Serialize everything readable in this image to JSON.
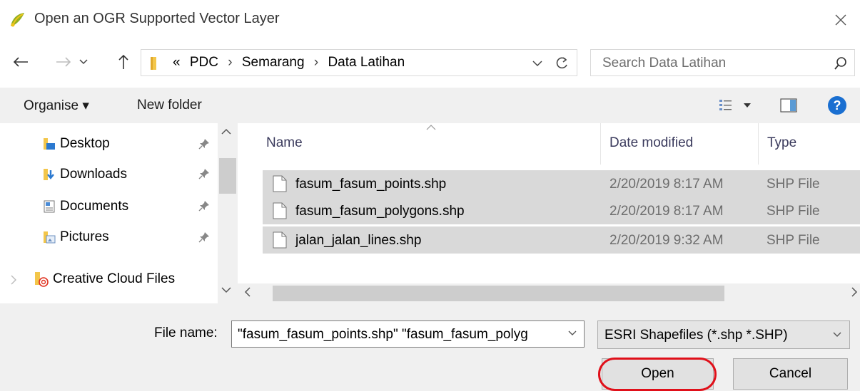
{
  "window": {
    "title": "Open an OGR Supported Vector Layer"
  },
  "address": {
    "overflow": "«",
    "crumbs": [
      "PDC",
      "Semarang",
      "Data Latihan"
    ]
  },
  "search": {
    "placeholder": "Search Data Latihan"
  },
  "toolbar": {
    "organise_label": "Organise ▾",
    "new_folder_label": "New folder"
  },
  "sidebar": {
    "items": [
      {
        "label": "Desktop"
      },
      {
        "label": "Downloads"
      },
      {
        "label": "Documents"
      },
      {
        "label": "Pictures"
      },
      {
        "label": "Creative Cloud Files"
      }
    ]
  },
  "columns": {
    "name": "Name",
    "date": "Date modified",
    "type": "Type"
  },
  "files": [
    {
      "name": "fasum_fasum_points.shp",
      "date": "2/20/2019 8:17 AM",
      "type": "SHP File"
    },
    {
      "name": "fasum_fasum_polygons.shp",
      "date": "2/20/2019 8:17 AM",
      "type": "SHP File"
    },
    {
      "name": "jalan_jalan_lines.shp",
      "date": "2/20/2019 9:32 AM",
      "type": "SHP File"
    }
  ],
  "bottom": {
    "file_name_label": "File name:",
    "file_name_value": "\"fasum_fasum_points.shp\" \"fasum_fasum_polyg",
    "filter_value": "ESRI Shapefiles (*.shp *.SHP)",
    "open_label": "Open",
    "cancel_label": "Cancel"
  },
  "colors": {
    "accent_highlight": "#e0101a",
    "help_blue": "#1a6fd1",
    "selected_row": "#d9d9d9",
    "folder_yellow": "#f3c64a"
  }
}
